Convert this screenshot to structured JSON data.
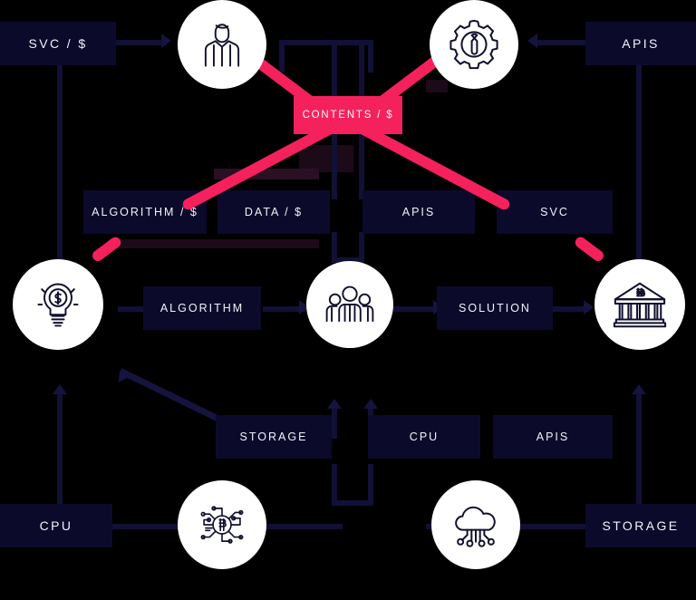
{
  "diagram": {
    "title": "Blockchain value-chain flow diagram",
    "background_color": "#000000",
    "box_color": "#0C0A2B",
    "accent_color": "#F5215C",
    "connector_color": "#15143F",
    "text_color": "#F2F2F7",
    "rows": [
      {
        "name": "top-row",
        "boxes": [
          "SVC / $",
          "APIS"
        ],
        "icons": [
          "businessman-icon",
          "gear-wrench-icon"
        ]
      },
      {
        "name": "contents-row",
        "boxes": [
          "CONTENTS / $"
        ]
      },
      {
        "name": "resource-row",
        "boxes": [
          "ALGORITHM / $",
          "DATA / $",
          "APIS",
          "SVC"
        ]
      },
      {
        "name": "process-row",
        "boxes": [
          "ALGORITHM",
          "SOLUTION"
        ],
        "icons": [
          "lightbulb-dollar-icon",
          "people-group-icon",
          "bank-bitcoin-icon"
        ]
      },
      {
        "name": "infrastructure-row",
        "boxes": [
          "STORAGE",
          "CPU",
          "APIS"
        ]
      },
      {
        "name": "bottom-row",
        "boxes": [
          "CPU",
          "STORAGE"
        ],
        "icons": [
          "bitcoin-circuit-icon",
          "cloud-network-icon"
        ]
      }
    ],
    "nodes": {
      "svc_money_top": "SVC / $",
      "apis_top": "APIS",
      "contents_money": "CONTENTS / $",
      "algorithm_money": "ALGORITHM / $",
      "data_money": "DATA / $",
      "apis_mid": "APIS",
      "svc_mid": "SVC",
      "algorithm": "ALGORITHM",
      "solution": "SOLUTION",
      "storage_mid": "STORAGE",
      "cpu_mid": "CPU",
      "apis_bottom": "APIS",
      "cpu_bottom": "CPU",
      "storage_bottom": "STORAGE"
    },
    "icons": {
      "businessman": "businessman-icon",
      "gear_wrench": "gear-wrench-icon",
      "lightbulb_dollar": "lightbulb-dollar-icon",
      "people_group": "people-group-icon",
      "bank_bitcoin": "bank-bitcoin-icon",
      "bitcoin_circuit": "bitcoin-circuit-icon",
      "cloud_network": "cloud-network-icon"
    }
  }
}
